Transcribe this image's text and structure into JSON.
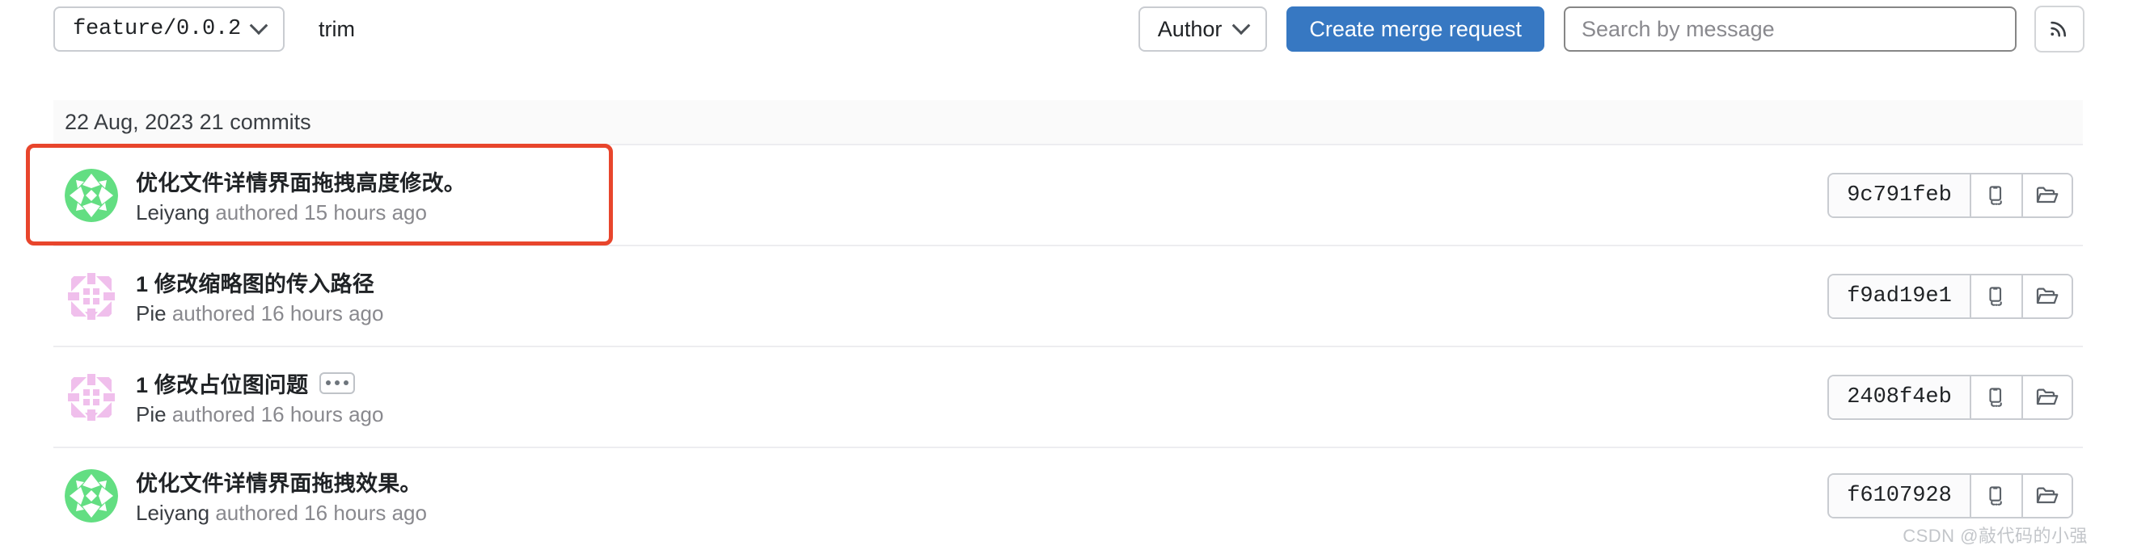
{
  "toolbar": {
    "branch": {
      "name": "feature/0.0.2",
      "icon": "chevron-down-icon"
    },
    "path_label": "trim",
    "author_filter": {
      "label": "Author",
      "icon": "chevron-down-icon"
    },
    "merge_request_button": "Create merge request",
    "search": {
      "value": "",
      "placeholder": "Search by message"
    },
    "rss_button": {
      "icon": "rss-feed-icon",
      "label": ""
    }
  },
  "date_header": {
    "text": "22 Aug, 2023 21 commits",
    "date": "22 Aug, 2023",
    "commit_count": "21 commits"
  },
  "commits": [
    {
      "title": "优化文件详情界面拖拽高度修改。",
      "author": "Leiyang",
      "meta_suffix": "authored 15 hours ago",
      "sha": "9c791feb",
      "avatar_color": "#63de82",
      "avatar_style": "green-identicon",
      "has_ellipsis": false,
      "highlighted": true
    },
    {
      "title": "1 修改缩略图的传入路径",
      "author": "Pie",
      "meta_suffix": "authored 16 hours ago",
      "sha": "f9ad19e1",
      "avatar_color": "#f0bfec",
      "avatar_style": "pink-identicon",
      "has_ellipsis": false,
      "highlighted": false
    },
    {
      "title": "1 修改占位图问题",
      "author": "Pie",
      "meta_suffix": "authored 16 hours ago",
      "sha": "2408f4eb",
      "avatar_color": "#f0bfec",
      "avatar_style": "pink-identicon",
      "has_ellipsis": true,
      "ellipsis_label": "•••",
      "highlighted": false
    },
    {
      "title": "优化文件详情界面拖拽效果。",
      "author": "Leiyang",
      "meta_suffix": "authored 16 hours ago",
      "sha": "f6107928",
      "avatar_color": "#63de82",
      "avatar_style": "green-identicon",
      "has_ellipsis": false,
      "highlighted": false
    }
  ],
  "row_actions": {
    "copy_icon": "copy-clipboard-icon",
    "browse_icon": "folder-open-icon"
  },
  "watermark": "CSDN @敲代码的小强",
  "colors": {
    "primary_blue": "#3778c2",
    "annotation_red": "#e8452c",
    "border_gray": "#c9ccd1",
    "text_dark": "#202326",
    "text_muted": "#89898e",
    "header_bg": "#fafafa"
  }
}
